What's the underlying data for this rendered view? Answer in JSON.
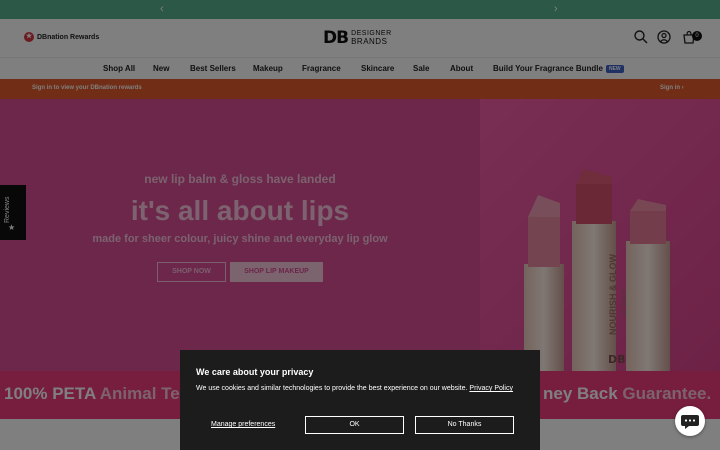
{
  "announcement": {
    "prev_icon": "chevron-left-icon",
    "next_icon": "chevron-right-icon",
    "color": "#56b08e"
  },
  "header": {
    "rewards_label": "DBnation Rewards",
    "logo_mark": "DB",
    "logo_line1": "DESIGNER",
    "logo_line2": "BRANDS",
    "cart_count": "0",
    "icons": [
      "search-icon",
      "account-icon",
      "cart-icon"
    ]
  },
  "nav": {
    "items": [
      "Shop All",
      "New",
      "Best Sellers",
      "Makeup",
      "Fragrance",
      "Skincare",
      "Sale",
      "About",
      "Build Your Fragrance Bundle"
    ],
    "new_badge": "NEW"
  },
  "signin_bar": {
    "left_text": "Sign in to view your DBnation rewards",
    "right_text": "Sign in",
    "color": "#e25b2b"
  },
  "hero": {
    "kicker": "new lip balm & gloss have landed",
    "headline": "it's all about lips",
    "subhead": "made for sheer colour, juicy shine and everyday lip glow",
    "shop_now": "SHOP NOW",
    "shop_lip_makeup": "SHOP LIP MAKEUP",
    "product_text": "NOURISH & GLOW",
    "product_sub": "LIP BALM",
    "product_logo": "DB",
    "color": "#d94f96"
  },
  "reviews_tab": {
    "label": "Reviews",
    "icon": "star-icon"
  },
  "promo": {
    "left_white": "100% PETA",
    "left_pink": "Animal Test",
    "right_white": "ney Back",
    "right_pink": "Guarantee.",
    "color": "#ef3b7b"
  },
  "cookie": {
    "title": "We care about your privacy",
    "body": "We use cookies and similar technologies to provide the best experience on our website.",
    "policy_link": "Privacy Policy",
    "manage": "Manage preferences",
    "ok": "OK",
    "no": "No Thanks"
  },
  "chat": {
    "icon": "chat-bubble-icon"
  }
}
